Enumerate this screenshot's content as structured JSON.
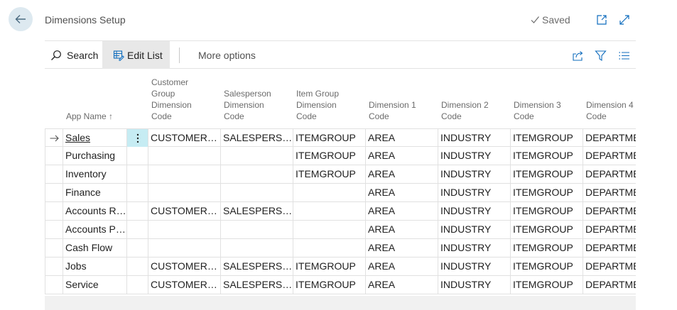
{
  "header": {
    "title": "Dimensions Setup",
    "saved_label": "Saved",
    "back_icon": "arrow-left-icon",
    "open_new_window_icon": "open-new-window-icon",
    "expand_icon": "expand-icon"
  },
  "toolbar": {
    "search_label": "Search",
    "edit_list_label": "Edit List",
    "more_options_label": "More options"
  },
  "columns": [
    {
      "key": "app",
      "label": "App Name",
      "sort": "↑"
    },
    {
      "key": "cg",
      "label": "Customer\nGroup\nDimension\nCode"
    },
    {
      "key": "sp",
      "label": "Salesperson\nDimension\nCode"
    },
    {
      "key": "ig",
      "label": "Item Group\nDimension\nCode"
    },
    {
      "key": "d1",
      "label": "Dimension 1\nCode"
    },
    {
      "key": "d2",
      "label": "Dimension 2\nCode"
    },
    {
      "key": "d3",
      "label": "Dimension 3\nCode"
    },
    {
      "key": "d4",
      "label": "Dimension 4\nCode"
    }
  ],
  "rows": [
    {
      "app": "Sales",
      "cg": "CUSTOMERGROUP",
      "sp": "SALESPERSON",
      "ig": "ITEMGROUP",
      "d1": "AREA",
      "d2": "INDUSTRY",
      "d3": "ITEMGROUP",
      "d4": "DEPARTMENT"
    },
    {
      "app": "Purchasing",
      "cg": "",
      "sp": "",
      "ig": "ITEMGROUP",
      "d1": "AREA",
      "d2": "INDUSTRY",
      "d3": "ITEMGROUP",
      "d4": "DEPARTMENT"
    },
    {
      "app": "Inventory",
      "cg": "",
      "sp": "",
      "ig": "ITEMGROUP",
      "d1": "AREA",
      "d2": "INDUSTRY",
      "d3": "ITEMGROUP",
      "d4": "DEPARTMENT"
    },
    {
      "app": "Finance",
      "cg": "",
      "sp": "",
      "ig": "",
      "d1": "AREA",
      "d2": "INDUSTRY",
      "d3": "ITEMGROUP",
      "d4": "DEPARTMENT"
    },
    {
      "app": "Accounts Receivable",
      "cg": "CUSTOMERGROUP",
      "sp": "SALESPERSON",
      "ig": "",
      "d1": "AREA",
      "d2": "INDUSTRY",
      "d3": "ITEMGROUP",
      "d4": "DEPARTMENT"
    },
    {
      "app": "Accounts Payable",
      "cg": "",
      "sp": "",
      "ig": "",
      "d1": "AREA",
      "d2": "INDUSTRY",
      "d3": "ITEMGROUP",
      "d4": "DEPARTMENT"
    },
    {
      "app": "Cash Flow",
      "cg": "",
      "sp": "",
      "ig": "",
      "d1": "AREA",
      "d2": "INDUSTRY",
      "d3": "ITEMGROUP",
      "d4": "DEPARTMENT"
    },
    {
      "app": "Jobs",
      "cg": "CUSTOMERGROUP",
      "sp": "SALESPERSON",
      "ig": "ITEMGROUP",
      "d1": "AREA",
      "d2": "INDUSTRY",
      "d3": "ITEMGROUP",
      "d4": "DEPARTMENT"
    },
    {
      "app": "Service",
      "cg": "CUSTOMERGROUP",
      "sp": "SALESPERSON",
      "ig": "ITEMGROUP",
      "d1": "AREA",
      "d2": "INDUSTRY",
      "d3": "ITEMGROUP",
      "d4": "DEPARTMENT"
    }
  ],
  "colors": {
    "accent": "#0f6cbd",
    "selected_cell": "#c6ecf3",
    "back_button_bg": "#dde9f0"
  }
}
